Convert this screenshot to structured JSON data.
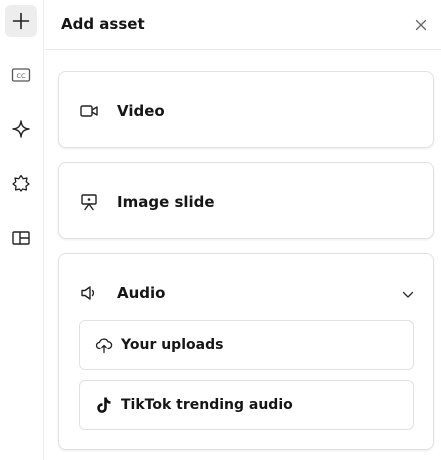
{
  "header": {
    "title": "Add asset"
  },
  "rail": {
    "items": [
      {
        "icon": "plus-icon",
        "active": true
      },
      {
        "icon": "closed-captions-icon",
        "active": false
      },
      {
        "icon": "sparkle-icon",
        "active": false
      },
      {
        "icon": "puzzle-icon",
        "active": false
      },
      {
        "icon": "layout-icon",
        "active": false
      }
    ]
  },
  "assets": {
    "video": {
      "label": "Video",
      "icon": "video-camera-icon"
    },
    "image_slide": {
      "label": "Image slide",
      "icon": "image-slide-icon"
    },
    "audio": {
      "label": "Audio",
      "icon": "speaker-icon",
      "expanded": true,
      "options": [
        {
          "label": "Your uploads",
          "icon": "cloud-upload-icon"
        },
        {
          "label": "TikTok trending audio",
          "icon": "tiktok-icon"
        }
      ]
    }
  }
}
